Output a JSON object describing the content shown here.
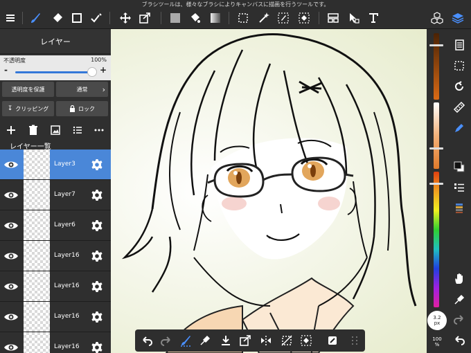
{
  "hint_text": "ブラシツールは、様々なブラシによりキャンバスに描画を行うツールです。",
  "layer_panel": {
    "title": "レイヤー",
    "opacity_label": "不透明度",
    "opacity_value": "100%",
    "opacity_fraction": 1.0,
    "protect_alpha_label": "透明度を保護",
    "blend_mode_label": "通常",
    "clipping_label": "クリッピング",
    "lock_label": "ロック",
    "list_title": "レイヤー一覧",
    "layers": [
      {
        "name": "Layer3",
        "active": true
      },
      {
        "name": "Layer7",
        "active": false
      },
      {
        "name": "Layer6",
        "active": false
      },
      {
        "name": "Layer16",
        "active": false
      },
      {
        "name": "Layer16",
        "active": false
      },
      {
        "name": "Layer16",
        "active": false
      },
      {
        "name": "Layer16",
        "active": false
      }
    ]
  },
  "right_panel": {
    "brush_size": "3.2",
    "brush_size_unit": "px",
    "zoom_value": "100",
    "zoom_unit": "%"
  },
  "colors": {
    "accent": "#4a87d8",
    "active_tool": "#4a90ff"
  }
}
